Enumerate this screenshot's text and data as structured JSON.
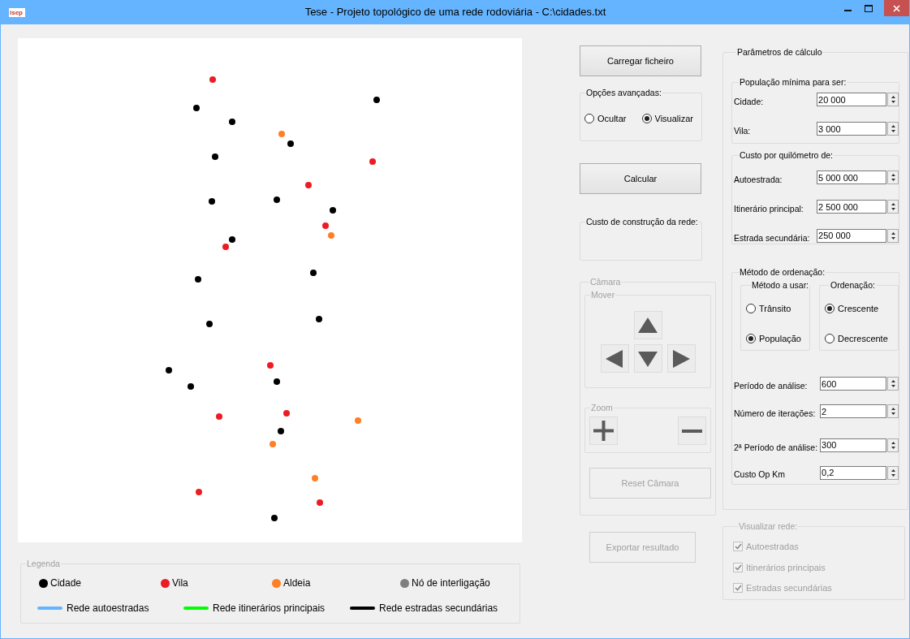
{
  "window": {
    "logo": "isep",
    "title": "Tese - Projeto topológico de uma rede rodoviária - C:\\cidades.txt"
  },
  "legend": {
    "title": "Legenda",
    "nodes": [
      {
        "label": "Cidade",
        "color": "#000000"
      },
      {
        "label": "Vila",
        "color": "#ed1c24"
      },
      {
        "label": "Aldeia",
        "color": "#ff7f27"
      },
      {
        "label": "Nó de interligação",
        "color": "#7f7f7f"
      }
    ],
    "lines": [
      {
        "label": "Rede autoestradas",
        "color": "#64b4ff"
      },
      {
        "label": "Rede itinerários principais",
        "color": "#00ff00"
      },
      {
        "label": "Rede estradas secundárias",
        "color": "#000000"
      }
    ]
  },
  "load_button": "Carregar ficheiro",
  "advanced_options": {
    "title": "Opções avançadas:",
    "options": [
      {
        "label": "Ocultar",
        "selected": false
      },
      {
        "label": "Visualizar",
        "selected": true
      }
    ]
  },
  "calculate_button": "Calcular",
  "network_cost": {
    "title": "Custo de construção da rede:"
  },
  "camera": {
    "title": "Câmara",
    "disabled": true,
    "move_title": "Mover",
    "zoom_title": "Zoom",
    "reset_button": "Reset Câmara"
  },
  "export_button": {
    "label": "Exportar resultado",
    "disabled": true
  },
  "parameters": {
    "title": "Parâmetros de cálculo",
    "min_population": {
      "title": "População mínima para ser:",
      "fields": [
        {
          "label": "Cidade:",
          "value": "20 000"
        },
        {
          "label": "Vila:",
          "value": "3 000"
        }
      ]
    },
    "cost_per_km": {
      "title": "Custo por quilómetro de:",
      "fields": [
        {
          "label": "Autoestrada:",
          "value": "5 000 000"
        },
        {
          "label": "Itinerário principal:",
          "value": "2 500 000"
        },
        {
          "label": "Estrada secundária:",
          "value": "250 000"
        }
      ]
    },
    "sorting": {
      "title": "Método de ordenação:",
      "method": {
        "title": "Método a usar:",
        "options": [
          {
            "label": "Trânsito",
            "selected": false
          },
          {
            "label": "População",
            "selected": true
          }
        ]
      },
      "order": {
        "title": "Ordenação:",
        "options": [
          {
            "label": "Crescente",
            "selected": true
          },
          {
            "label": "Decrescente",
            "selected": false
          }
        ]
      },
      "fields": [
        {
          "label": "Período de análise:",
          "value": "600"
        },
        {
          "label": "Número de iterações:",
          "value": "2"
        },
        {
          "label": "2ª Período de análise:",
          "value": "300"
        },
        {
          "label": "Custo Op Km",
          "value": "0,2"
        }
      ]
    }
  },
  "network_view": {
    "title": "Visualizar rede:",
    "disabled": true,
    "items": [
      {
        "label": "Autoestradas",
        "checked": true
      },
      {
        "label": "Itinerários principais",
        "checked": true
      },
      {
        "label": "Estradas secundárias",
        "checked": true
      }
    ]
  }
}
